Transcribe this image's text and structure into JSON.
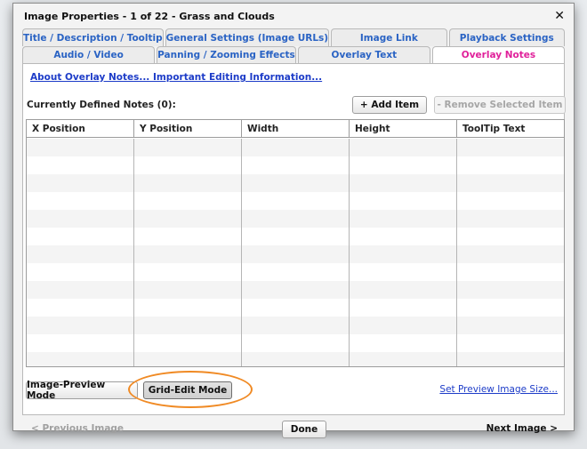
{
  "dialog": {
    "title": "Image Properties - 1 of 22 - Grass and Clouds",
    "close_label": "✕"
  },
  "tabs": {
    "row1": [
      {
        "label": "Title / Description / Tooltip"
      },
      {
        "label": "General Settings (Image URLs)"
      },
      {
        "label": "Image Link"
      },
      {
        "label": "Playback Settings"
      }
    ],
    "row2": [
      {
        "label": "Audio / Video"
      },
      {
        "label": "Panning / Zooming Effects"
      },
      {
        "label": "Overlay Text"
      },
      {
        "label": "Overlay Notes"
      }
    ],
    "active": "Overlay Notes"
  },
  "content": {
    "about_link": "About Overlay Notes... Important Editing Information...",
    "notes_label": "Currently Defined Notes (0):",
    "add_button": "+ Add Item",
    "remove_button": "- Remove Selected Item",
    "columns": [
      "X Position",
      "Y Position",
      "Width",
      "Height",
      "ToolTip Text"
    ],
    "preview_mode_button": "Image-Preview Mode",
    "grid_mode_button": "Grid-Edit Mode",
    "preview_size_link": "Set Preview Image Size..."
  },
  "footer": {
    "prev_label": "< Previous Image",
    "done_label": "Done",
    "next_label": "Next Image >"
  },
  "colors": {
    "tab_text": "#2a63c4",
    "active_tab_text": "#e0209a",
    "link": "#1d3cc8",
    "highlight": "#f08a24"
  }
}
